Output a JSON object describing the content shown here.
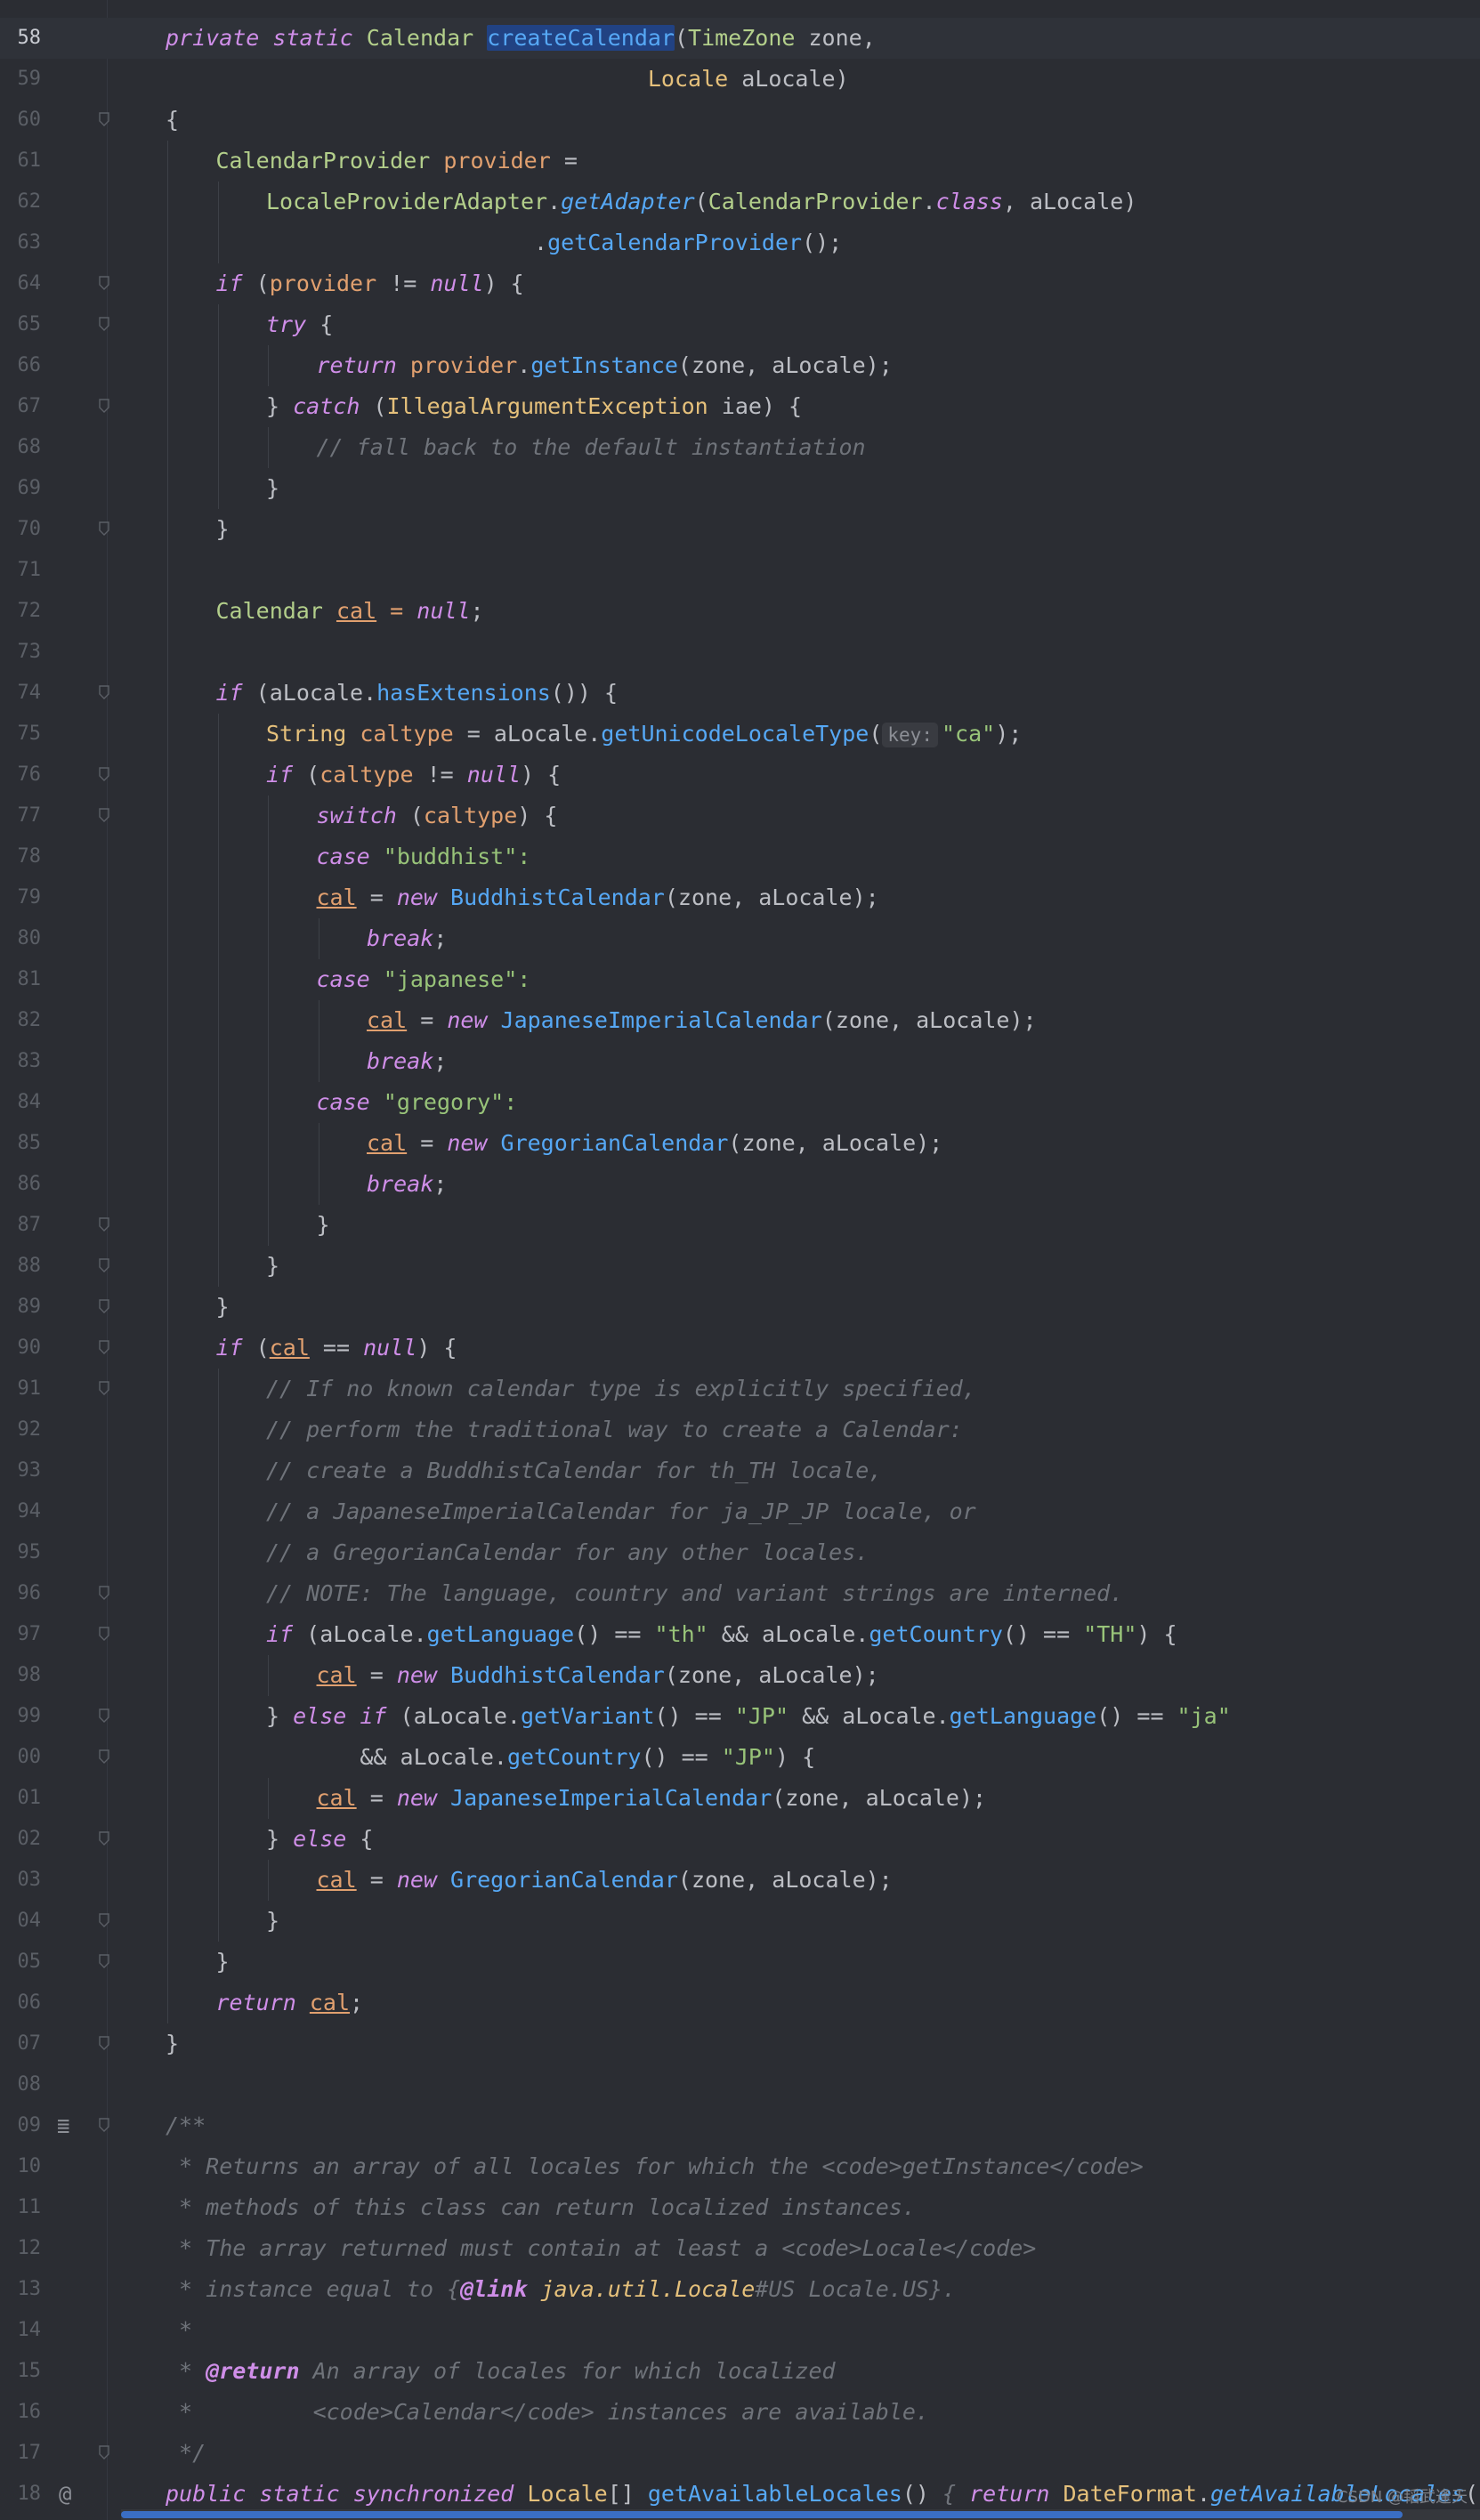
{
  "editor": {
    "current_line": "58",
    "gutter_icons": {
      "doc_render": "render-doc-icon",
      "override": "@"
    },
    "param_hint": "key:",
    "watermark": "CSDN @韬武逢天",
    "lines": [
      {
        "n": "58",
        "indent": 0,
        "fold": false,
        "current": true,
        "tokens": [
          [
            "k",
            "private static "
          ],
          [
            "t",
            "Calendar "
          ],
          [
            "fn sel",
            "createCalendar"
          ],
          [
            "",
            "("
          ],
          [
            "t",
            "TimeZone"
          ],
          [
            "",
            " zone,"
          ]
        ]
      },
      {
        "n": "59",
        "indent": 0,
        "fold": false,
        "tokens": [
          [
            "",
            "                                    "
          ],
          [
            "tc",
            "Locale"
          ],
          [
            "",
            " aLocale)"
          ]
        ]
      },
      {
        "n": "60",
        "indent": 0,
        "fold": true,
        "tokens": [
          [
            "",
            "{"
          ]
        ]
      },
      {
        "n": "61",
        "indent": 1,
        "fold": false,
        "tokens": [
          [
            "t",
            "CalendarProvider "
          ],
          [
            "v",
            "provider"
          ],
          [
            "",
            " ="
          ]
        ]
      },
      {
        "n": "62",
        "indent": 2,
        "fold": false,
        "tokens": [
          [
            "t",
            "LocaleProviderAdapter"
          ],
          [
            "",
            "."
          ],
          [
            "fi",
            "getAdapter"
          ],
          [
            "",
            "("
          ],
          [
            "t",
            "CalendarProvider"
          ],
          [
            "",
            "."
          ],
          [
            "k",
            "class"
          ],
          [
            "",
            ", aLocale)"
          ]
        ]
      },
      {
        "n": "63",
        "indent": 2,
        "fold": false,
        "tokens": [
          [
            "",
            "                    ."
          ],
          [
            "fn",
            "getCalendarProvider"
          ],
          [
            "",
            "();"
          ]
        ]
      },
      {
        "n": "64",
        "indent": 1,
        "fold": true,
        "tokens": [
          [
            "k",
            "if"
          ],
          [
            "",
            " ("
          ],
          [
            "v",
            "provider"
          ],
          [
            "",
            " != "
          ],
          [
            "k",
            "null"
          ],
          [
            "",
            ") {"
          ]
        ]
      },
      {
        "n": "65",
        "indent": 2,
        "fold": true,
        "tokens": [
          [
            "k",
            "try"
          ],
          [
            "",
            " {"
          ]
        ]
      },
      {
        "n": "66",
        "indent": 3,
        "fold": false,
        "tokens": [
          [
            "k",
            "return "
          ],
          [
            "v",
            "provider"
          ],
          [
            "",
            "."
          ],
          [
            "fn",
            "getInstance"
          ],
          [
            "",
            "(zone, aLocale);"
          ]
        ]
      },
      {
        "n": "67",
        "indent": 2,
        "fold": true,
        "tokens": [
          [
            "",
            "} "
          ],
          [
            "k",
            "catch"
          ],
          [
            "",
            " ("
          ],
          [
            "tc",
            "IllegalArgumentException"
          ],
          [
            "",
            " iae) {"
          ]
        ]
      },
      {
        "n": "68",
        "indent": 3,
        "fold": false,
        "tokens": [
          [
            "c",
            "// fall back to the default instantiation"
          ]
        ]
      },
      {
        "n": "69",
        "indent": 2,
        "fold": false,
        "tokens": [
          [
            "",
            "}"
          ]
        ]
      },
      {
        "n": "70",
        "indent": 1,
        "fold": true,
        "tokens": [
          [
            "",
            "}"
          ]
        ]
      },
      {
        "n": "71",
        "indent": 0,
        "fold": false,
        "tokens": []
      },
      {
        "n": "72",
        "indent": 1,
        "fold": false,
        "tokens": [
          [
            "t",
            "Calendar "
          ],
          [
            "vu",
            "cal"
          ],
          [
            "v",
            " = "
          ],
          [
            "k",
            "null"
          ],
          [
            "",
            ";"
          ]
        ]
      },
      {
        "n": "73",
        "indent": 0,
        "fold": false,
        "tokens": []
      },
      {
        "n": "74",
        "indent": 1,
        "fold": true,
        "tokens": [
          [
            "k",
            "if"
          ],
          [
            "",
            " (aLocale."
          ],
          [
            "fn",
            "hasExtensions"
          ],
          [
            "",
            "()) {"
          ]
        ]
      },
      {
        "n": "75",
        "indent": 2,
        "fold": false,
        "tokens": [
          [
            "tc",
            "String "
          ],
          [
            "v",
            "caltype"
          ],
          [
            "",
            " = aLocale."
          ],
          [
            "fn",
            "getUnicodeLocaleType"
          ],
          [
            "",
            "("
          ],
          [
            "hint",
            "key:"
          ],
          [
            "s",
            "\"ca\""
          ],
          [
            "",
            ");"
          ]
        ]
      },
      {
        "n": "76",
        "indent": 2,
        "fold": true,
        "tokens": [
          [
            "k",
            "if"
          ],
          [
            "",
            " ("
          ],
          [
            "v",
            "caltype"
          ],
          [
            "",
            " != "
          ],
          [
            "k",
            "null"
          ],
          [
            "",
            ") {"
          ]
        ]
      },
      {
        "n": "77",
        "indent": 3,
        "fold": true,
        "tokens": [
          [
            "k",
            "switch"
          ],
          [
            "",
            " ("
          ],
          [
            "v",
            "caltype"
          ],
          [
            "",
            ") {"
          ]
        ]
      },
      {
        "n": "78",
        "indent": 3,
        "fold": false,
        "tokens": [
          [
            "k",
            "case "
          ],
          [
            "s",
            "\"buddhist\""
          ],
          [
            "s",
            ":"
          ]
        ]
      },
      {
        "n": "79",
        "indent": 3,
        "fold": false,
        "tokens": [
          [
            "vu",
            "cal"
          ],
          [
            "",
            " = "
          ],
          [
            "k",
            "new "
          ],
          [
            "fn",
            "BuddhistCalendar"
          ],
          [
            "",
            "(zone, aLocale);"
          ]
        ]
      },
      {
        "n": "80",
        "indent": 4,
        "fold": false,
        "tokens": [
          [
            "k",
            "break"
          ],
          [
            "",
            ";"
          ]
        ]
      },
      {
        "n": "81",
        "indent": 3,
        "fold": false,
        "tokens": [
          [
            "k",
            "case "
          ],
          [
            "s",
            "\"japanese\""
          ],
          [
            "s",
            ":"
          ]
        ]
      },
      {
        "n": "82",
        "indent": 4,
        "fold": false,
        "tokens": [
          [
            "vu",
            "cal"
          ],
          [
            "",
            " = "
          ],
          [
            "k",
            "new "
          ],
          [
            "fn",
            "JapaneseImperialCalendar"
          ],
          [
            "",
            "(zone, aLocale);"
          ]
        ]
      },
      {
        "n": "83",
        "indent": 4,
        "fold": false,
        "tokens": [
          [
            "k",
            "break"
          ],
          [
            "",
            ";"
          ]
        ]
      },
      {
        "n": "84",
        "indent": 3,
        "fold": false,
        "tokens": [
          [
            "k",
            "case "
          ],
          [
            "s",
            "\"gregory\""
          ],
          [
            "s",
            ":"
          ]
        ]
      },
      {
        "n": "85",
        "indent": 4,
        "fold": false,
        "tokens": [
          [
            "vu",
            "cal"
          ],
          [
            "",
            " = "
          ],
          [
            "k",
            "new "
          ],
          [
            "fn",
            "GregorianCalendar"
          ],
          [
            "",
            "(zone, aLocale);"
          ]
        ]
      },
      {
        "n": "86",
        "indent": 4,
        "fold": false,
        "tokens": [
          [
            "k",
            "break"
          ],
          [
            "",
            ";"
          ]
        ]
      },
      {
        "n": "87",
        "indent": 3,
        "fold": true,
        "tokens": [
          [
            "",
            "}"
          ]
        ]
      },
      {
        "n": "88",
        "indent": 2,
        "fold": true,
        "tokens": [
          [
            "",
            "}"
          ]
        ]
      },
      {
        "n": "89",
        "indent": 1,
        "fold": true,
        "tokens": [
          [
            "",
            "}"
          ]
        ]
      },
      {
        "n": "90",
        "indent": 1,
        "fold": true,
        "tokens": [
          [
            "k",
            "if"
          ],
          [
            "",
            " ("
          ],
          [
            "vu",
            "cal"
          ],
          [
            "",
            " == "
          ],
          [
            "k",
            "null"
          ],
          [
            "",
            ") {"
          ]
        ]
      },
      {
        "n": "91",
        "indent": 2,
        "fold": true,
        "tokens": [
          [
            "c",
            "// If no known calendar type is explicitly specified,"
          ]
        ]
      },
      {
        "n": "92",
        "indent": 2,
        "fold": false,
        "tokens": [
          [
            "c",
            "// perform the traditional way to create a Calendar:"
          ]
        ]
      },
      {
        "n": "93",
        "indent": 2,
        "fold": false,
        "tokens": [
          [
            "c",
            "// create a BuddhistCalendar for th_TH locale,"
          ]
        ]
      },
      {
        "n": "94",
        "indent": 2,
        "fold": false,
        "tokens": [
          [
            "c",
            "// a JapaneseImperialCalendar for ja_JP_JP locale, or"
          ]
        ]
      },
      {
        "n": "95",
        "indent": 2,
        "fold": false,
        "tokens": [
          [
            "c",
            "// a GregorianCalendar for any other locales."
          ]
        ]
      },
      {
        "n": "96",
        "indent": 2,
        "fold": true,
        "tokens": [
          [
            "c",
            "// NOTE: The language, country and variant strings are interned."
          ]
        ]
      },
      {
        "n": "97",
        "indent": 2,
        "fold": true,
        "tokens": [
          [
            "k",
            "if"
          ],
          [
            "",
            " (aLocale."
          ],
          [
            "fn",
            "getLanguage"
          ],
          [
            "",
            "() == "
          ],
          [
            "s",
            "\"th\""
          ],
          [
            "",
            " && aLocale."
          ],
          [
            "fn",
            "getCountry"
          ],
          [
            "",
            "() == "
          ],
          [
            "s",
            "\"TH\""
          ],
          [
            "",
            ") {"
          ]
        ]
      },
      {
        "n": "98",
        "indent": 3,
        "fold": false,
        "tokens": [
          [
            "vu",
            "cal"
          ],
          [
            "",
            " = "
          ],
          [
            "k",
            "new "
          ],
          [
            "fn",
            "BuddhistCalendar"
          ],
          [
            "",
            "(zone, aLocale);"
          ]
        ]
      },
      {
        "n": "99",
        "indent": 2,
        "fold": true,
        "tokens": [
          [
            "",
            "} "
          ],
          [
            "k",
            "else if"
          ],
          [
            "",
            " (aLocale."
          ],
          [
            "fn",
            "getVariant"
          ],
          [
            "",
            "() == "
          ],
          [
            "s",
            "\"JP\""
          ],
          [
            "",
            " && aLocale."
          ],
          [
            "fn",
            "getLanguage"
          ],
          [
            "",
            "() == "
          ],
          [
            "s",
            "\"ja\""
          ]
        ]
      },
      {
        "n": "00",
        "indent": 2,
        "fold": true,
        "tokens": [
          [
            "",
            "       && aLocale."
          ],
          [
            "fn",
            "getCountry"
          ],
          [
            "",
            "() == "
          ],
          [
            "s",
            "\"JP\""
          ],
          [
            "",
            ") {"
          ]
        ]
      },
      {
        "n": "01",
        "indent": 3,
        "fold": false,
        "tokens": [
          [
            "vu",
            "cal"
          ],
          [
            "",
            " = "
          ],
          [
            "k",
            "new "
          ],
          [
            "fn",
            "JapaneseImperialCalendar"
          ],
          [
            "",
            "(zone, aLocale);"
          ]
        ]
      },
      {
        "n": "02",
        "indent": 2,
        "fold": true,
        "tokens": [
          [
            "",
            "} "
          ],
          [
            "k",
            "else"
          ],
          [
            "",
            " {"
          ]
        ]
      },
      {
        "n": "03",
        "indent": 3,
        "fold": false,
        "tokens": [
          [
            "vu",
            "cal"
          ],
          [
            "",
            " = "
          ],
          [
            "k",
            "new "
          ],
          [
            "fn",
            "GregorianCalendar"
          ],
          [
            "",
            "(zone, aLocale);"
          ]
        ]
      },
      {
        "n": "04",
        "indent": 2,
        "fold": true,
        "tokens": [
          [
            "",
            "}"
          ]
        ]
      },
      {
        "n": "05",
        "indent": 1,
        "fold": true,
        "tokens": [
          [
            "",
            "}"
          ]
        ]
      },
      {
        "n": "06",
        "indent": 1,
        "fold": false,
        "tokens": [
          [
            "k",
            "return "
          ],
          [
            "vu",
            "cal"
          ],
          [
            "",
            ";"
          ]
        ]
      },
      {
        "n": "07",
        "indent": 0,
        "fold": true,
        "tokens": [
          [
            "",
            "}"
          ]
        ]
      },
      {
        "n": "08",
        "indent": 0,
        "fold": false,
        "tokens": []
      },
      {
        "n": "09",
        "indent": 0,
        "fold": true,
        "doc_icon": true,
        "tokens": [
          [
            "c",
            "/**"
          ]
        ]
      },
      {
        "n": "10",
        "indent": 0,
        "fold": false,
        "tokens": [
          [
            "c",
            " * Returns an array of all locales for which the <code>getInstance</code>"
          ]
        ]
      },
      {
        "n": "11",
        "indent": 0,
        "fold": false,
        "tokens": [
          [
            "c",
            " * methods of this class can return localized instances."
          ]
        ]
      },
      {
        "n": "12",
        "indent": 0,
        "fold": false,
        "tokens": [
          [
            "c",
            " * The array returned must contain at least a <code>Locale</code>"
          ]
        ]
      },
      {
        "n": "13",
        "indent": 0,
        "fold": false,
        "tokens": [
          [
            "c",
            " * instance equal to {"
          ],
          [
            "an",
            "@link "
          ],
          [
            "ly",
            "java.util.Locale"
          ],
          [
            "c",
            "#US Locale.US}."
          ]
        ]
      },
      {
        "n": "14",
        "indent": 0,
        "fold": false,
        "tokens": [
          [
            "c",
            " *"
          ]
        ]
      },
      {
        "n": "15",
        "indent": 0,
        "fold": false,
        "tokens": [
          [
            "c",
            " * "
          ],
          [
            "an",
            "@return"
          ],
          [
            "c",
            " An array of locales for which localized"
          ]
        ]
      },
      {
        "n": "16",
        "indent": 0,
        "fold": false,
        "tokens": [
          [
            "c",
            " *         <code>Calendar</code> instances are available."
          ]
        ]
      },
      {
        "n": "17",
        "indent": 0,
        "fold": true,
        "tokens": [
          [
            "c",
            " */"
          ]
        ]
      },
      {
        "n": "18",
        "indent": 0,
        "fold": false,
        "override": true,
        "tokens": [
          [
            "k",
            "public static synchronized "
          ],
          [
            "tc",
            "Locale"
          ],
          [
            "",
            "[] "
          ],
          [
            "fn",
            "getAvailableLocales"
          ],
          [
            "",
            "() "
          ],
          [
            "c",
            "{ "
          ],
          [
            "k",
            "return "
          ],
          [
            "tc",
            "DateFormat"
          ],
          [
            "",
            "."
          ],
          [
            "fi",
            "getAvailableLocales"
          ],
          [
            "",
            "(); "
          ],
          [
            "c",
            "}"
          ]
        ]
      }
    ]
  }
}
